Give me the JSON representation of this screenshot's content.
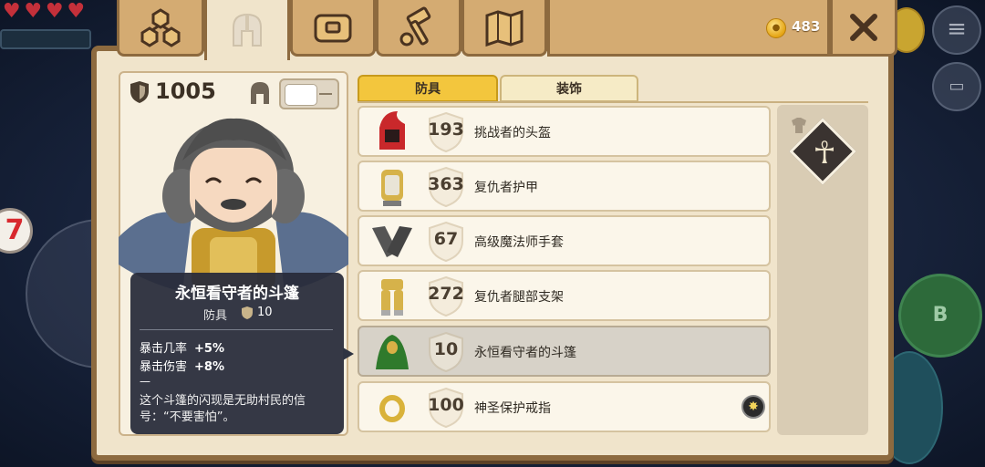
{
  "hud": {
    "hearts": [
      "heart",
      "heart",
      "heart",
      "heart"
    ],
    "level_badge": "7",
    "button_b": "B"
  },
  "tabs": [
    {
      "id": "skills",
      "icon": "skill-tree-icon",
      "active": false
    },
    {
      "id": "equipment",
      "icon": "helmet-icon",
      "active": true
    },
    {
      "id": "inventory",
      "icon": "chest-icon",
      "active": false
    },
    {
      "id": "crafting",
      "icon": "hammer-icon",
      "active": false
    },
    {
      "id": "map",
      "icon": "map-icon",
      "active": false
    }
  ],
  "coins": {
    "value": "483"
  },
  "close": {
    "icon": "close-icon"
  },
  "character": {
    "defense": "1005"
  },
  "tooltip": {
    "title": "永恒看守者的斗篷",
    "type": "防具",
    "defense": "10",
    "stats": [
      {
        "label": "暴击几率",
        "value": "+5%"
      },
      {
        "label": "暴击伤害",
        "value": "+8%"
      }
    ],
    "dash": "—",
    "description": "这个斗篷的闪现是无助村民的信号：“不要害怕”。"
  },
  "categories": {
    "armor": "防具",
    "accessories": "装饰"
  },
  "items": [
    {
      "defense": "193",
      "name": "挑战者的头盔",
      "icon": "red-hood-helmet-icon",
      "selected": false
    },
    {
      "defense": "363",
      "name": "复仇者护甲",
      "icon": "gold-armor-icon",
      "selected": false
    },
    {
      "defense": "67",
      "name": "高级魔法师手套",
      "icon": "gauntlets-icon",
      "selected": false
    },
    {
      "defense": "272",
      "name": "复仇者腿部支架",
      "icon": "leg-armor-icon",
      "selected": false
    },
    {
      "defense": "10",
      "name": "永恒看守者的斗篷",
      "icon": "green-cloak-icon",
      "selected": true
    },
    {
      "defense": "100",
      "name": "神圣保护戒指",
      "icon": "gold-ring-icon",
      "selected": false,
      "badge": "star-badge-icon"
    }
  ],
  "slot": {
    "icon": "ankh-icon",
    "symbol": "☥"
  },
  "colors": {
    "wood": "#d4ab72",
    "parchment": "#f0e4cb",
    "active_category": "#f3c63d",
    "tooltip_bg": "#282c3a"
  }
}
